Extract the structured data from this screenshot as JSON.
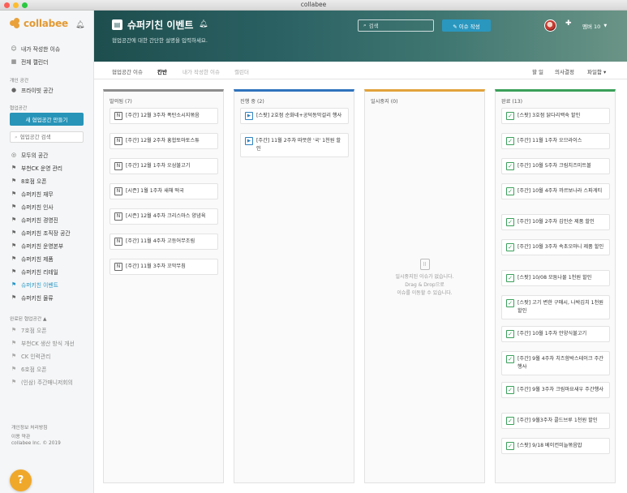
{
  "window": {
    "title": "collabee"
  },
  "sidebar": {
    "logo_text": "collabee",
    "quick_items": [
      {
        "label": "내가 작성한 이슈",
        "icon": "smile-icon"
      },
      {
        "label": "전체 캘린더",
        "icon": "calendar-icon"
      }
    ],
    "private_heading": "개인 공간",
    "private_item": "프라이빗 공간",
    "ws_heading": "협업공간",
    "new_ws_button": "새 협업공간 만들기",
    "search_placeholder": "협업공간 검색",
    "workspaces": [
      {
        "label": "모두의 공간",
        "icon": "globe-icon"
      },
      {
        "label": "부천CK 운영 관리",
        "icon": "flag-icon"
      },
      {
        "label": "8호점 오픈",
        "icon": "flag-icon"
      },
      {
        "label": "슈퍼키친 재무",
        "icon": "flag-icon"
      },
      {
        "label": "슈퍼키친 인사",
        "icon": "flag-icon"
      },
      {
        "label": "슈퍼키친 경영진",
        "icon": "flag-icon"
      },
      {
        "label": "슈퍼키친 조직장 공간",
        "icon": "flag-icon"
      },
      {
        "label": "슈퍼키친 운영본부",
        "icon": "flag-icon"
      },
      {
        "label": "슈퍼키친 제품",
        "icon": "flag-icon"
      },
      {
        "label": "슈퍼키친 리테일",
        "icon": "flag-icon"
      },
      {
        "label": "슈퍼키친 이벤트",
        "icon": "flag-icon",
        "active": true
      },
      {
        "label": "슈퍼키친 물류",
        "icon": "flag-icon"
      }
    ],
    "done_heading": "완료된 협업공간 ▲",
    "done_workspaces": [
      "7호점 오픈",
      "부천CK 생산 방식 개선",
      "CK 인력관리",
      "6호점 오픈",
      "(인삼) 주간매니저회의"
    ],
    "footer": [
      "개인정보 처리방침",
      "이용 약관",
      "collabee Inc. © 2019"
    ],
    "help_icon": "question-icon"
  },
  "header": {
    "title": "슈퍼키친 이벤트",
    "description": "협업공간에 대한 간단한 설명을 입력하세요.",
    "search_placeholder": "검색",
    "write_button": "✎ 이슈 작성",
    "members_label": "멤버 10"
  },
  "tabs": [
    {
      "label": "협업공간 이슈",
      "state": "normal"
    },
    {
      "label": "칸반",
      "state": "active"
    },
    {
      "label": "내가 작성한 이슈",
      "state": "light"
    },
    {
      "label": "캘린더",
      "state": "light"
    }
  ],
  "right_tabs": [
    "할 일",
    "의사결정",
    "파일함 ▾"
  ],
  "columns": [
    {
      "title": "발의됨 (7)",
      "color": "#8d8d8d",
      "icon": "note-icon",
      "cards": [
        "[주간] 12월 3주차 폭탄소시지볶음",
        "[주간] 12월 2주차 홍합토마토스튜",
        "[주간] 12월 1주차 오삼불고기",
        "[시즌] 1월 1주차 새해 떡국",
        "[시즌] 12월 4주차 크리스마스 양념육",
        "[주간] 11월 4주차 고등어무조림",
        "[주간] 11월 3주차 꼬막무침"
      ]
    },
    {
      "title": "진행 중 (2)",
      "color": "#2f73bd",
      "icon": "play-icon",
      "cards": [
        "[스팟] 2호점 순화네+공덕동막걸리 행사",
        "[주간] 11월 2주차 따뜻한 '국' 1천원 할인"
      ]
    },
    {
      "title": "일시중지 (0)",
      "color": "#e2a23a",
      "icon": "pause-icon",
      "cards": [],
      "empty_lines": [
        "일시중지된 이슈가 없습니다.",
        "Drag & Drop으로",
        "이슈를 이동할 수 있습니다."
      ]
    },
    {
      "title": "완료 (13)",
      "color": "#3aa05a",
      "icon": "check-icon",
      "cards": [
        "[스팟] 3호점 닭다리백숙 할인",
        "[주간] 11월 1주차 오므라이스",
        "[주간] 10월 5주차 크림치즈미트볼",
        "[주간] 10월 4주차 까르보나라 스파게티",
        "[주간] 10월 2주차 김인순 제품 할인",
        "[주간] 10월 3주차 속초오마니 제품 할인",
        "[스팟] 10/08 모둠나물 1천원 할인",
        "[스팟] 고기 변한 구매시, 나박김치 1천원 할인",
        "[주간] 10월 1주차 안양식불고기",
        "[주간] 9월 4주차 치즈함박스테이크 주간행사",
        "[주간] 9월 3주차 크림마요새우 주간행사",
        "[주간] 9월3주차 콜드브루 1천원 할인",
        "[스팟] 9/18 베이컨미늘볶음밥"
      ]
    }
  ]
}
